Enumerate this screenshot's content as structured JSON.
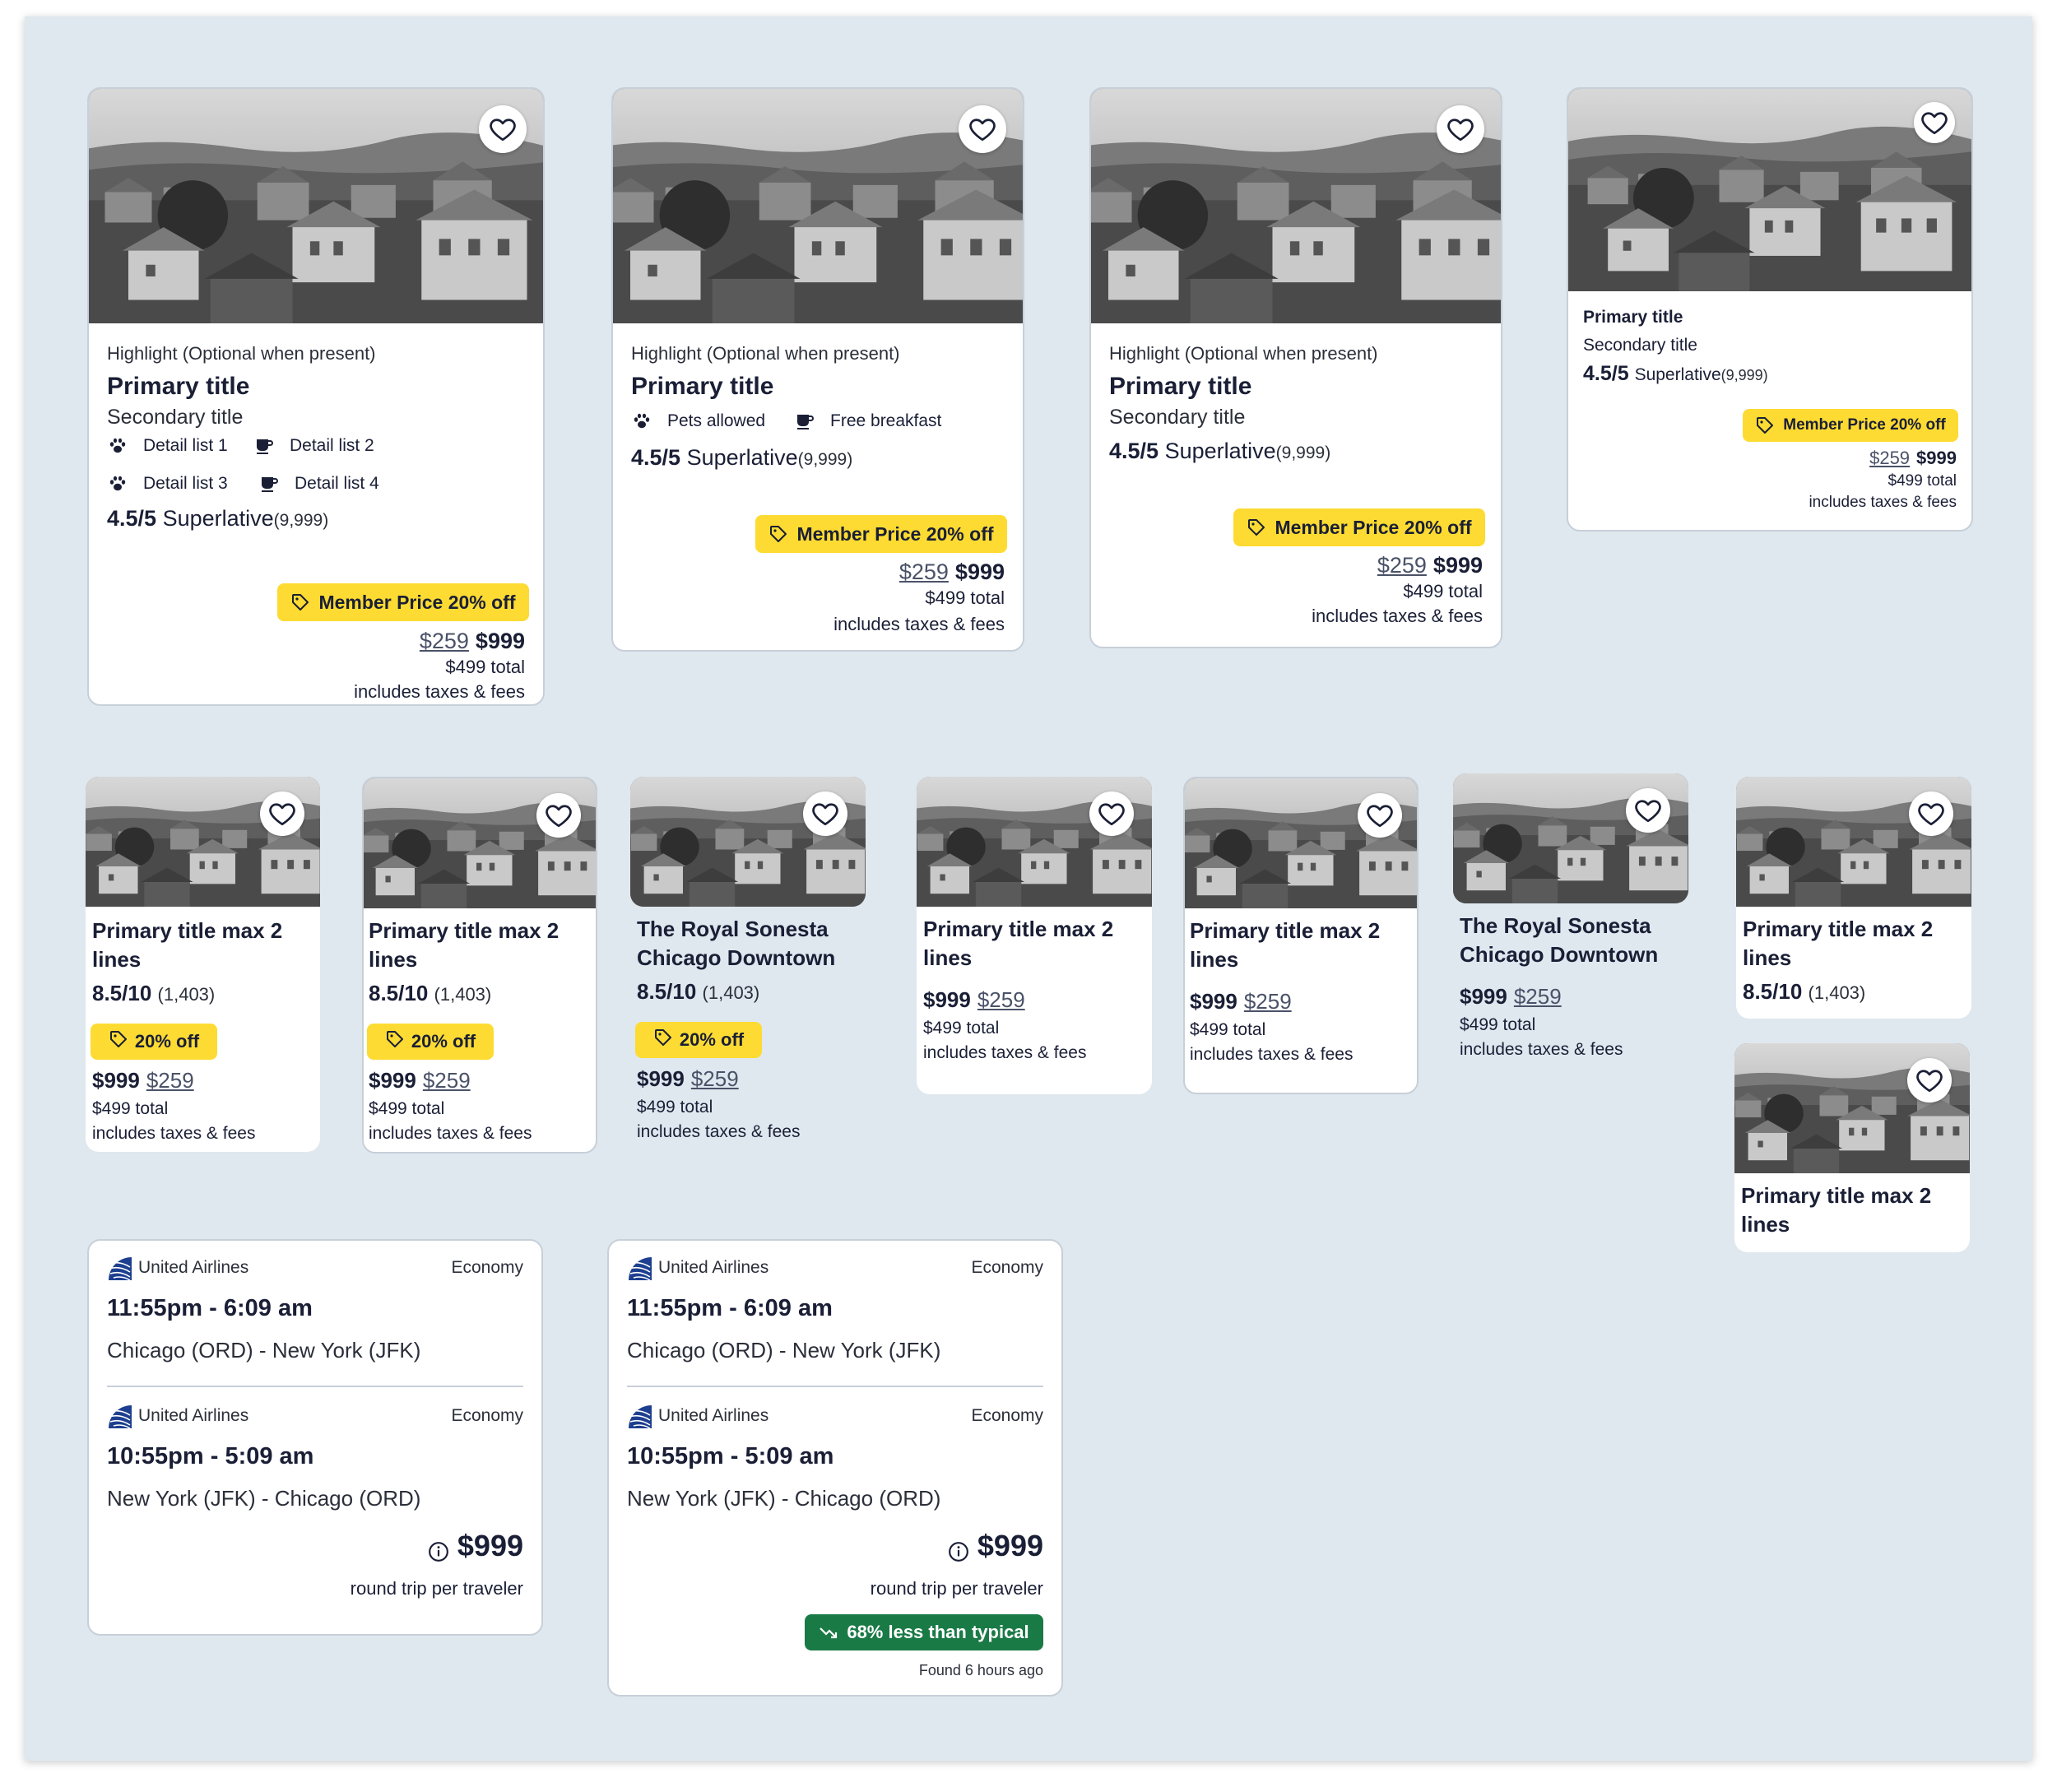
{
  "colors": {
    "background": "#dfe8ef",
    "badge_yellow": "#fddb32",
    "deal_green": "#1a7a46",
    "text_dark": "#1a1f36"
  },
  "icons": [
    "heart-icon",
    "paw-icon",
    "coffee-cup-icon",
    "price-tag-icon",
    "info-circle-icon",
    "trend-down-icon",
    "united-airlines-logo"
  ],
  "large_cards": [
    {
      "highlight": "Highlight (Optional when present)",
      "primary_title": "Primary title",
      "secondary_title": "Secondary title",
      "details": [
        "Detail list 1",
        "Detail list 2",
        "Detail list 3",
        "Detail list 4"
      ],
      "rating": "4.5/5",
      "rating_label": "Superlative",
      "rating_count": "(9,999)",
      "badge": "Member Price 20% off",
      "old_price": "$259",
      "price": "$999",
      "total": "$499 total",
      "fees": "includes taxes & fees"
    },
    {
      "highlight": "Highlight (Optional when present)",
      "primary_title": "Primary title",
      "amenities": [
        "Pets allowed",
        "Free breakfast"
      ],
      "rating": "4.5/5",
      "rating_label": "Superlative",
      "rating_count": "(9,999)",
      "badge": "Member Price 20% off",
      "old_price": "$259",
      "price": "$999",
      "total": "$499 total",
      "fees": "includes taxes & fees"
    },
    {
      "highlight": "Highlight (Optional when present)",
      "primary_title": "Primary title",
      "secondary_title": "Secondary title",
      "rating": "4.5/5",
      "rating_label": "Superlative",
      "rating_count": "(9,999)",
      "badge": "Member Price 20% off",
      "old_price": "$259",
      "price": "$999",
      "total": "$499 total",
      "fees": "includes taxes & fees"
    },
    {
      "primary_title": "Primary title",
      "secondary_title": "Secondary title",
      "rating": "4.5/5",
      "rating_label": "Superlative",
      "rating_count": "(9,999)",
      "badge": "Member Price 20% off",
      "old_price": "$259",
      "price": "$999",
      "total": "$499 total",
      "fees": "includes taxes & fees"
    }
  ],
  "small_cards": [
    {
      "title": "Primary title max 2 lines",
      "rating": "8.5/10",
      "rating_count": "(1,403)",
      "badge": "20% off",
      "price": "$999",
      "old_price": "$259",
      "total": "$499 total",
      "fees": "includes taxes & fees"
    },
    {
      "title": "Primary title max 2 lines",
      "rating": "8.5/10",
      "rating_count": "(1,403)",
      "badge": "20% off",
      "price": "$999",
      "old_price": "$259",
      "total": "$499 total",
      "fees": "includes taxes & fees"
    },
    {
      "title": "The Royal Sonesta Chicago Downtown",
      "rating": "8.5/10",
      "rating_count": "(1,403)",
      "badge": "20% off",
      "price": "$999",
      "old_price": "$259",
      "total": "$499 total",
      "fees": "includes taxes & fees"
    },
    {
      "title": "Primary title max 2 lines",
      "price": "$999",
      "old_price": "$259",
      "total": "$499 total",
      "fees": "includes taxes & fees"
    },
    {
      "title": "Primary title max 2 lines",
      "price": "$999",
      "old_price": "$259",
      "total": "$499 total",
      "fees": "includes taxes & fees"
    },
    {
      "title": "The Royal Sonesta Chicago Downtown",
      "price": "$999",
      "old_price": "$259",
      "total": "$499 total",
      "fees": "includes taxes & fees"
    },
    {
      "title": "Primary title max 2 lines",
      "rating": "8.5/10",
      "rating_count": "(1,403)"
    },
    {
      "title": "Primary title max 2 lines"
    }
  ],
  "flight_cards": [
    {
      "legs": [
        {
          "airline": "United Airlines",
          "cabin": "Economy",
          "time": "11:55pm - 6:09 am",
          "route": "Chicago (ORD) - New York (JFK)"
        },
        {
          "airline": "United Airlines",
          "cabin": "Economy",
          "time": "10:55pm - 5:09 am",
          "route": "New York (JFK) - Chicago (ORD)"
        }
      ],
      "price": "$999",
      "price_note": "round trip per traveler"
    },
    {
      "legs": [
        {
          "airline": "United Airlines",
          "cabin": "Economy",
          "time": "11:55pm - 6:09 am",
          "route": "Chicago (ORD) - New York (JFK)"
        },
        {
          "airline": "United Airlines",
          "cabin": "Economy",
          "time": "10:55pm - 5:09 am",
          "route": "New York (JFK) - Chicago (ORD)"
        }
      ],
      "price": "$999",
      "price_note": "round trip per traveler",
      "deal_badge": "68% less than typical",
      "found": "Found 6 hours ago"
    }
  ]
}
